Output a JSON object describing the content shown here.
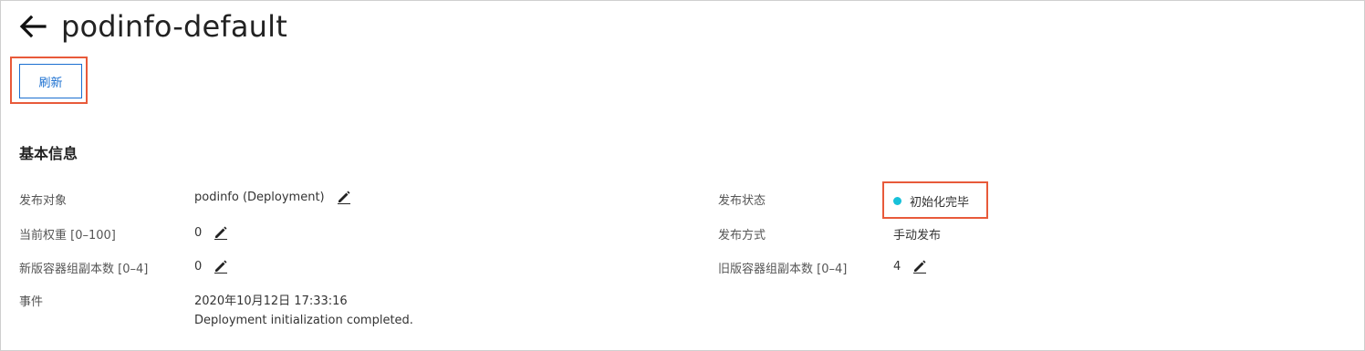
{
  "header": {
    "title": "podinfo-default"
  },
  "toolbar": {
    "refresh_label": "刷新"
  },
  "section": {
    "title": "基本信息"
  },
  "fields": {
    "target_label": "发布对象",
    "target_value": "podinfo (Deployment)",
    "weight_label": "当前权重 [0–100]",
    "weight_value": "0",
    "new_replicas_label": "新版容器组副本数 [0–4]",
    "new_replicas_value": "0",
    "event_label": "事件",
    "event_time": "2020年10月12日 17:33:16",
    "event_message": "Deployment initialization completed.",
    "status_label": "发布状态",
    "status_value": "初始化完毕",
    "method_label": "发布方式",
    "method_value": "手动发布",
    "old_replicas_label": "旧版容器组副本数 [0–4]",
    "old_replicas_value": "4"
  },
  "icons": {
    "back": "arrow-left-icon",
    "edit": "pencil-icon"
  },
  "colors": {
    "accent": "#1a6fd0",
    "highlight": "#e85a3a",
    "status_dot": "#17c1d9"
  }
}
